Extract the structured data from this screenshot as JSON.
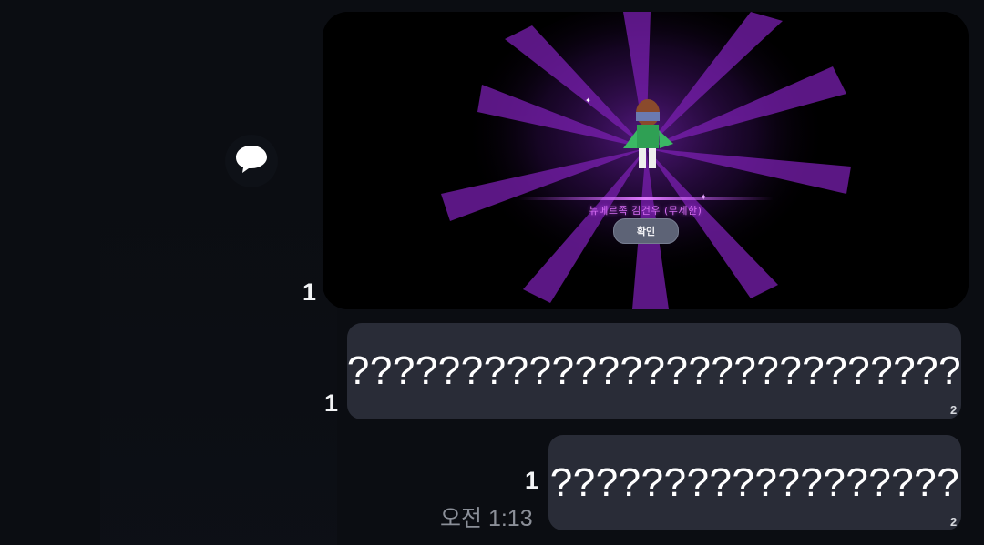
{
  "chat": {
    "reply_icon": "speech-bubble-icon",
    "image_message": {
      "unread_count": "1",
      "game_character_name": "뉴메르족 김건우 (무제한)",
      "game_confirm_label": "확인",
      "colors": {
        "ray": "#7a1fb0",
        "glow": "#c44dff",
        "name": "#d46cf0"
      }
    },
    "messages": [
      {
        "text": "???????????????????????????",
        "unread_count": "1",
        "reaction_count": "2"
      },
      {
        "text": "??????????????????",
        "unread_count": "1",
        "reaction_count": "2"
      }
    ],
    "timestamp": "오전 1:13"
  },
  "colors": {
    "background": "#0b0d12",
    "bubble": "#292c37"
  }
}
